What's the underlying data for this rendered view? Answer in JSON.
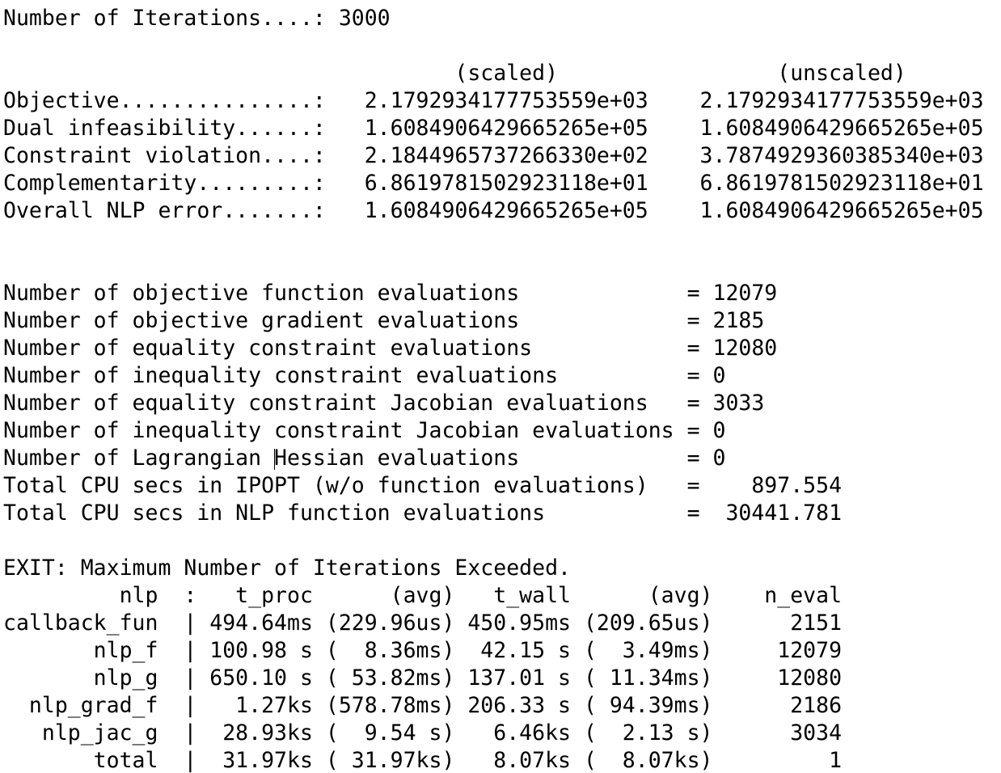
{
  "terminal": {
    "lines": [
      "Number of Iterations....: 3000",
      "",
      "                                   (scaled)                 (unscaled)",
      "Objective...............:   2.1792934177753559e+03    2.1792934177753559e+03",
      "Dual infeasibility......:   1.6084906429665265e+05    1.6084906429665265e+05",
      "Constraint violation....:   2.1844965737266330e+02    3.7874929360385340e+03",
      "Complementarity.........:   6.8619781502923118e+01    6.8619781502923118e+01",
      "Overall NLP error.......:   1.6084906429665265e+05    1.6084906429665265e+05",
      "",
      "",
      "Number of objective function evaluations             = 12079",
      "Number of objective gradient evaluations             = 2185",
      "Number of equality constraint evaluations            = 12080",
      "Number of inequality constraint evaluations          = 0",
      "Number of equality constraint Jacobian evaluations   = 3033",
      "Number of inequality constraint Jacobian evaluations = 0",
      "Number of Lagrangian Hessian evaluations             = 0",
      "Total CPU secs in IPOPT (w/o function evaluations)   =    897.554",
      "Total CPU secs in NLP function evaluations           =  30441.781",
      "",
      "EXIT: Maximum Number of Iterations Exceeded.",
      "         nlp  :   t_proc      (avg)   t_wall      (avg)    n_eval",
      "callback_fun  | 494.64ms (229.96us) 450.95ms (209.65us)      2151",
      "       nlp_f  | 100.98 s (  8.36ms)  42.15 s (  3.49ms)     12079",
      "       nlp_g  | 650.10 s ( 53.82ms) 137.01 s ( 11.34ms)     12080",
      "  nlp_grad_f  |   1.27ks (578.78ms) 206.33 s ( 94.39ms)      2186",
      "   nlp_jac_g  |  28.93ks (  9.54 s)   6.46ks (  2.13 s)      3034",
      "       total  |  31.97ks ( 31.97ks)   8.07ks (  8.07ks)         1"
    ]
  }
}
